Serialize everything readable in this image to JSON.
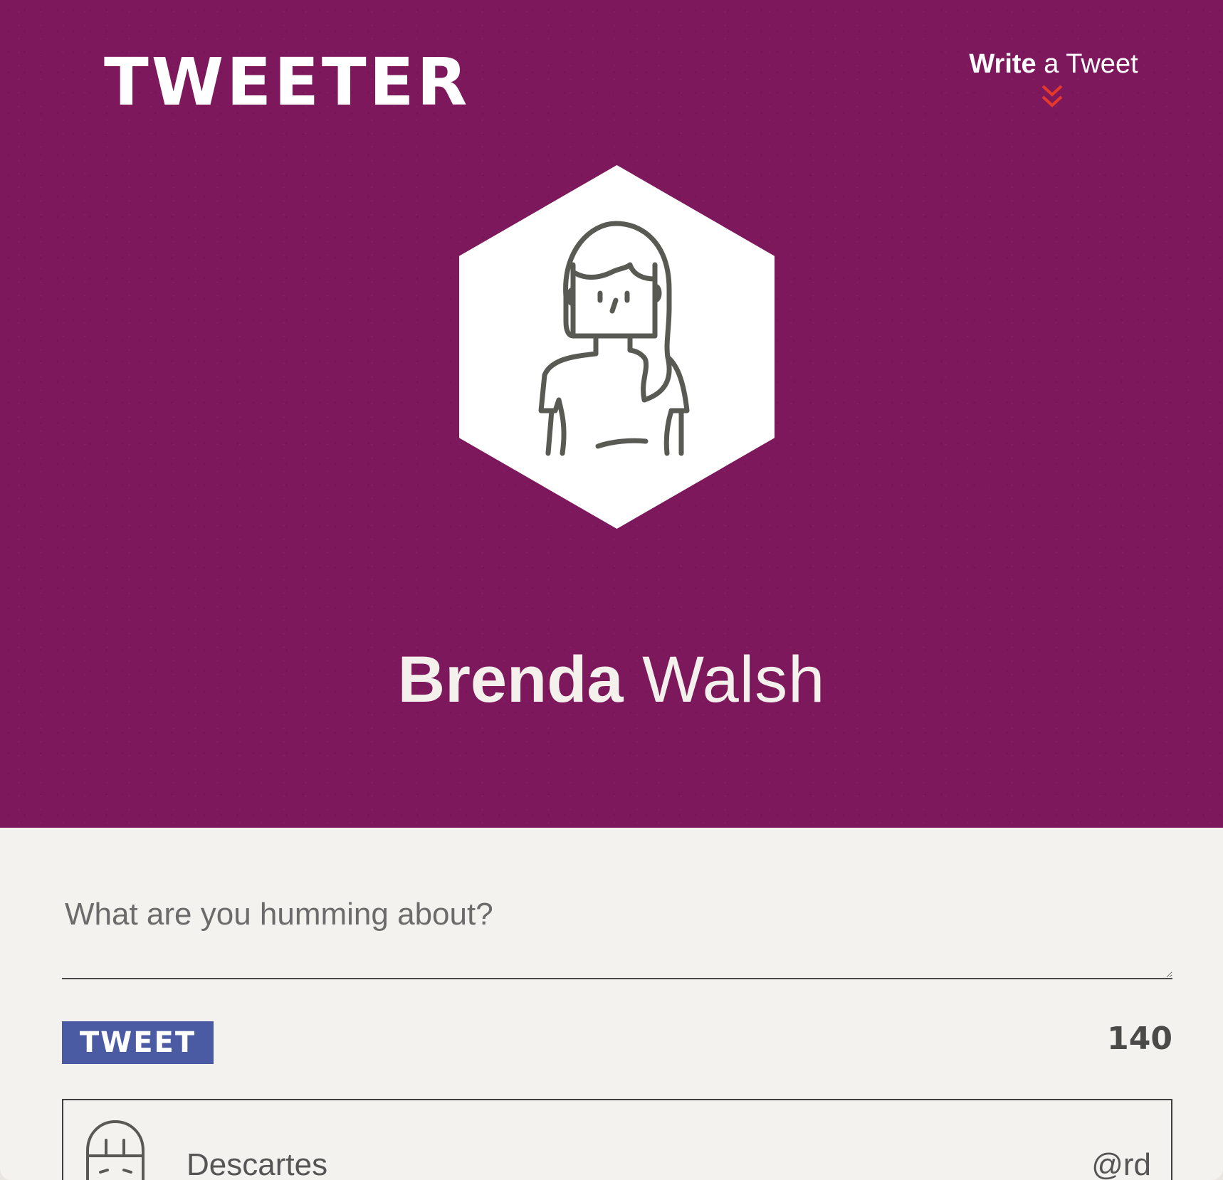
{
  "app": {
    "logo": "TWEETER"
  },
  "nav": {
    "write_bold": "Write",
    "write_rest": " a Tweet"
  },
  "profile": {
    "first_name": "Brenda",
    "last_name": " Walsh"
  },
  "compose": {
    "placeholder": "What are you humming about?",
    "value": ""
  },
  "actions": {
    "tweet_label": "TWEET",
    "char_count": "140"
  },
  "tweets": [
    {
      "name": "Descartes",
      "handle": "@rd"
    }
  ],
  "colors": {
    "header_bg": "#7e185c",
    "body_bg": "#f4f2ee",
    "button_bg": "#4a5aa3",
    "chevron": "#e53a2a",
    "icon_stroke": "#5a5a55"
  },
  "icons": {
    "chevron": "double-chevron-down-icon",
    "avatar": "woman-avatar-icon",
    "card_avatar": "person-avatar-icon"
  }
}
